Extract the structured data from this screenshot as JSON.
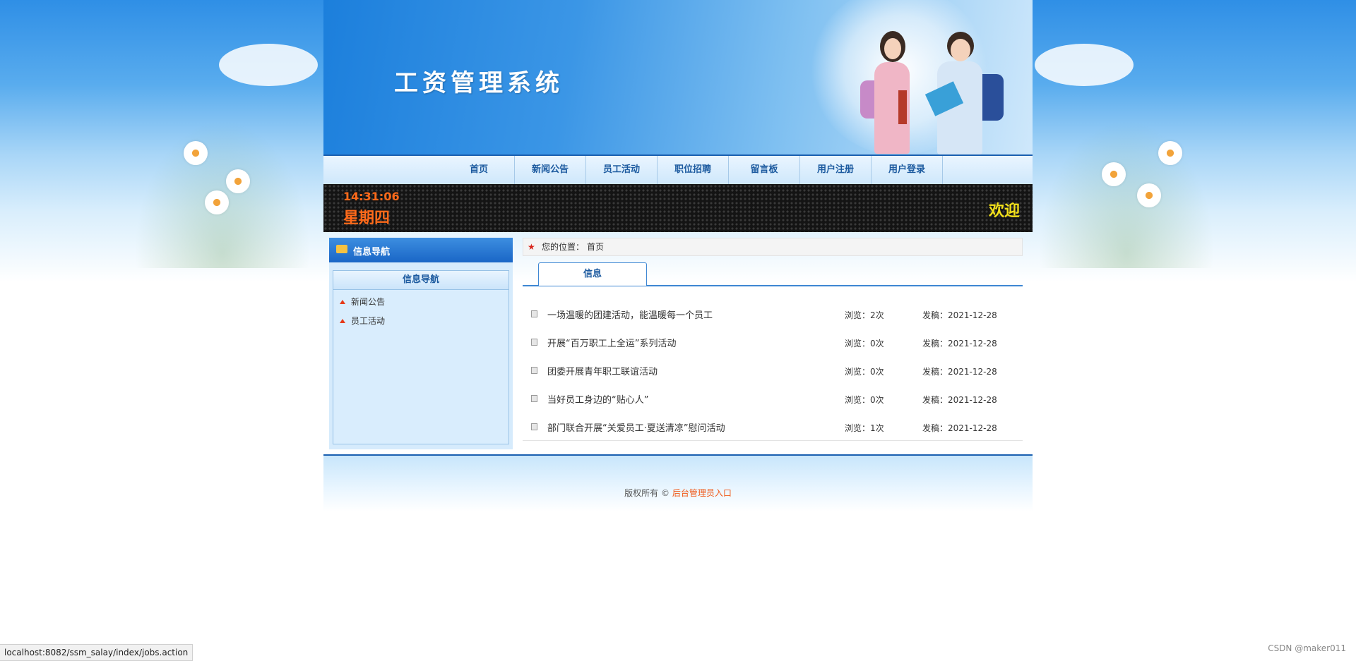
{
  "banner": {
    "site_title": "工资管理系统"
  },
  "nav": {
    "items": [
      {
        "label": "首页"
      },
      {
        "label": "新闻公告"
      },
      {
        "label": "员工活动"
      },
      {
        "label": "职位招聘"
      },
      {
        "label": "留言板"
      },
      {
        "label": "用户注册"
      },
      {
        "label": "用户登录"
      }
    ]
  },
  "led": {
    "time": "14:31:06",
    "weekday": "星期四",
    "welcome": "欢迎"
  },
  "sidebar": {
    "header": "信息导航",
    "box_title": "信息导航",
    "links": [
      {
        "label": "新闻公告"
      },
      {
        "label": "员工活动"
      }
    ]
  },
  "breadcrumb": {
    "label": "您的位置：",
    "current": "首页"
  },
  "tab": {
    "label": "信息"
  },
  "articles": [
    {
      "title": "一场温暖的团建活动，能温暖每一个员工",
      "views": "浏览：2次",
      "published": "发稿：2021-12-28"
    },
    {
      "title": "开展“百万职工上全运”系列活动",
      "views": "浏览：0次",
      "published": "发稿：2021-12-28"
    },
    {
      "title": "团委开展青年职工联谊活动",
      "views": "浏览：0次",
      "published": "发稿：2021-12-28"
    },
    {
      "title": "当好员工身边的“贴心人”",
      "views": "浏览：0次",
      "published": "发稿：2021-12-28"
    },
    {
      "title": "部门联合开展“关爱员工·夏送清凉”慰问活动",
      "views": "浏览：1次",
      "published": "发稿：2021-12-28"
    }
  ],
  "footer": {
    "copyright": "版权所有 © ",
    "admin_link": "后台管理员入口"
  },
  "statusbar": {
    "url": "localhost:8082/ssm_salay/index/jobs.action"
  },
  "watermark": "CSDN @maker011",
  "colors": {
    "nav_text": "#1c5a9f",
    "led_time": "#ff6a1a",
    "led_welcome": "#f2e01b",
    "admin_link": "#f05a1a"
  }
}
